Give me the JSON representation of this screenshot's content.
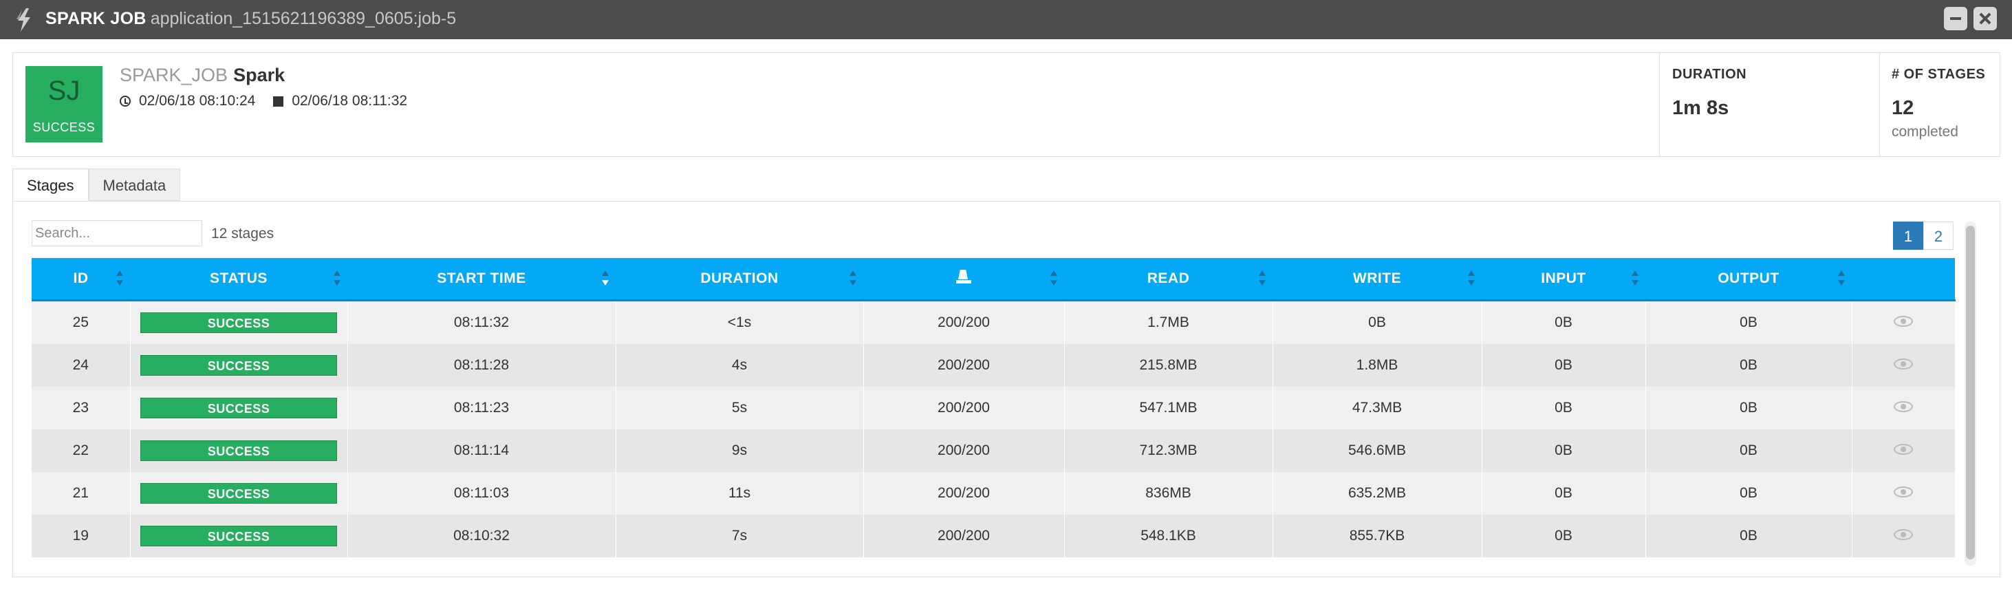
{
  "window": {
    "title_type": "SPARK JOB",
    "title_id": "application_1515621196389_0605:job-5"
  },
  "job": {
    "initials": "SJ",
    "status": "SUCCESS",
    "type_label": "SPARK_JOB",
    "name": "Spark",
    "start": "02/06/18 08:10:24",
    "end": "02/06/18 08:11:32",
    "status_color": "#27ae60"
  },
  "stats": {
    "duration_label": "DURATION",
    "duration_value": "1m 8s",
    "stages_label": "# OF STAGES",
    "stages_value": "12",
    "stages_sub": "completed"
  },
  "tabs": [
    {
      "label": "Stages",
      "active": true
    },
    {
      "label": "Metadata",
      "active": false
    }
  ],
  "toolbar": {
    "search_placeholder": "Search...",
    "count_text": "12 stages"
  },
  "pagination": [
    "1",
    "2"
  ],
  "table": {
    "header_color": "#03a9f4",
    "columns": [
      "ID",
      "STATUS",
      "START TIME",
      "DURATION",
      "",
      "READ",
      "WRITE",
      "INPUT",
      "OUTPUT",
      ""
    ],
    "rows": [
      {
        "id": "25",
        "status": "SUCCESS",
        "start": "08:11:32",
        "duration": "<1s",
        "tasks": "200/200",
        "read": "1.7MB",
        "write": "0B",
        "input": "0B",
        "output": "0B"
      },
      {
        "id": "24",
        "status": "SUCCESS",
        "start": "08:11:28",
        "duration": "4s",
        "tasks": "200/200",
        "read": "215.8MB",
        "write": "1.8MB",
        "input": "0B",
        "output": "0B"
      },
      {
        "id": "23",
        "status": "SUCCESS",
        "start": "08:11:23",
        "duration": "5s",
        "tasks": "200/200",
        "read": "547.1MB",
        "write": "47.3MB",
        "input": "0B",
        "output": "0B"
      },
      {
        "id": "22",
        "status": "SUCCESS",
        "start": "08:11:14",
        "duration": "9s",
        "tasks": "200/200",
        "read": "712.3MB",
        "write": "546.6MB",
        "input": "0B",
        "output": "0B"
      },
      {
        "id": "21",
        "status": "SUCCESS",
        "start": "08:11:03",
        "duration": "11s",
        "tasks": "200/200",
        "read": "836MB",
        "write": "635.2MB",
        "input": "0B",
        "output": "0B"
      },
      {
        "id": "19",
        "status": "SUCCESS",
        "start": "08:10:32",
        "duration": "7s",
        "tasks": "200/200",
        "read": "548.1KB",
        "write": "855.7KB",
        "input": "0B",
        "output": "0B"
      }
    ]
  }
}
